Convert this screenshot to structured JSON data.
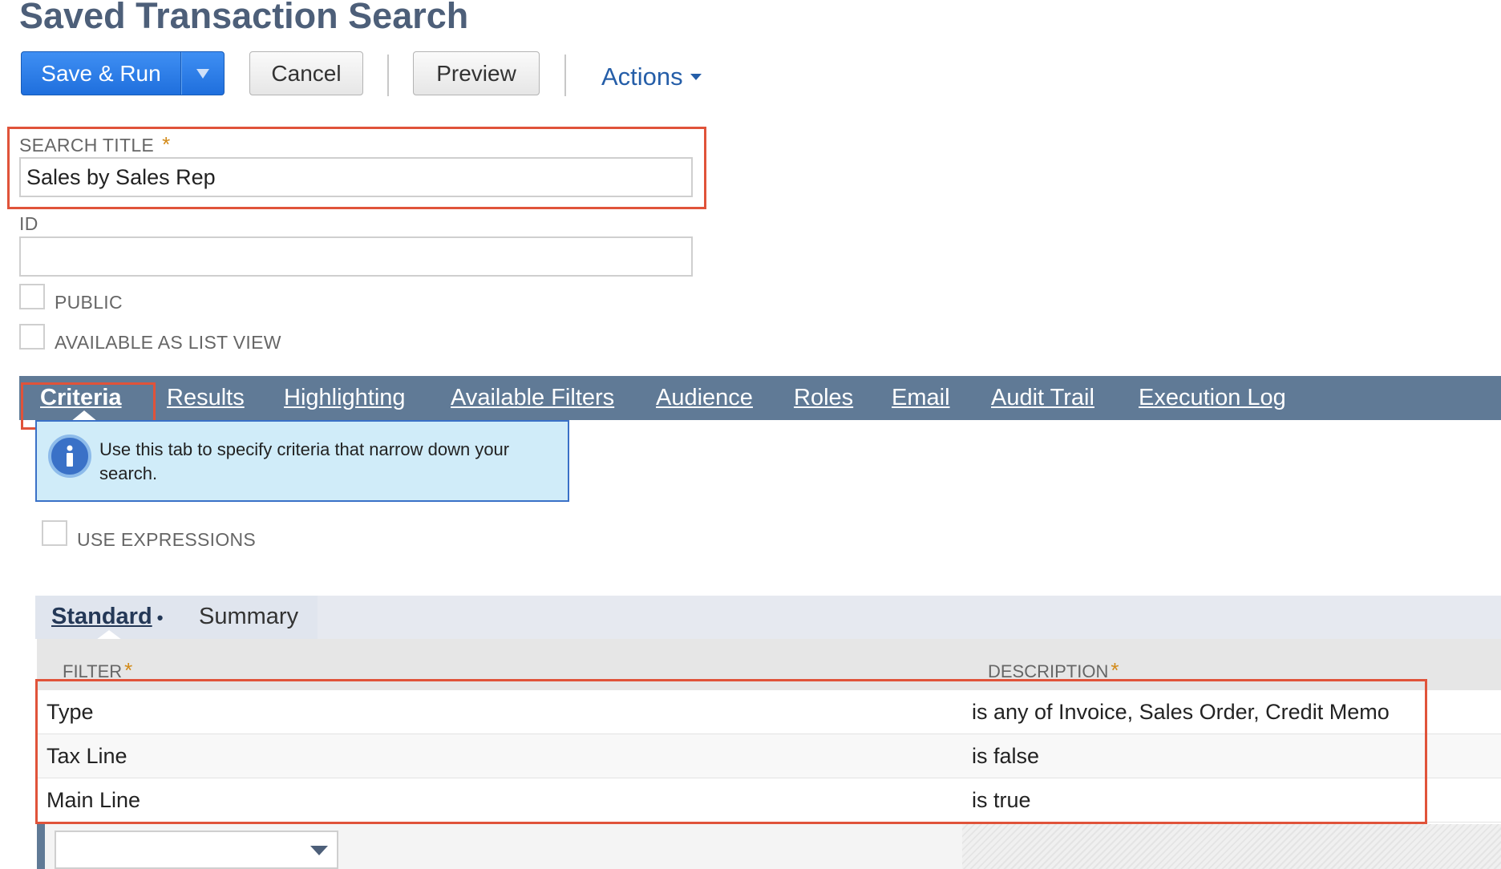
{
  "page": {
    "title": "Saved Transaction Search"
  },
  "toolbar": {
    "save_run_label": "Save & Run",
    "cancel_label": "Cancel",
    "preview_label": "Preview",
    "actions_label": "Actions"
  },
  "form": {
    "search_title_label": "SEARCH TITLE",
    "search_title_value": "Sales by Sales Rep",
    "id_label": "ID",
    "id_value": "",
    "public_label": "PUBLIC",
    "list_view_label": "AVAILABLE AS LIST VIEW",
    "required_marker": "*"
  },
  "tabs": [
    {
      "label": "Criteria",
      "active": true
    },
    {
      "label": "Results"
    },
    {
      "label": "Highlighting"
    },
    {
      "label": "Available Filters"
    },
    {
      "label": "Audience"
    },
    {
      "label": "Roles"
    },
    {
      "label": "Email"
    },
    {
      "label": "Audit Trail"
    },
    {
      "label": "Execution Log"
    }
  ],
  "info": {
    "text": "Use this tab to specify criteria that narrow down your search."
  },
  "criteria": {
    "use_expressions_label": "USE EXPRESSIONS",
    "subtabs": {
      "standard": "Standard",
      "summary": "Summary"
    },
    "columns": {
      "filter": "FILTER",
      "description": "DESCRIPTION"
    },
    "rows": [
      {
        "filter": "Type",
        "description": "is any of Invoice, Sales Order, Credit Memo"
      },
      {
        "filter": "Tax Line",
        "description": "is false"
      },
      {
        "filter": "Main Line",
        "description": "is true"
      }
    ]
  },
  "colors": {
    "tabbar": "#607a96",
    "primary_button": "#2a7ae8",
    "highlight_box": "#e0533a",
    "info_bg": "#d0ecf9",
    "required": "#d28a18"
  }
}
